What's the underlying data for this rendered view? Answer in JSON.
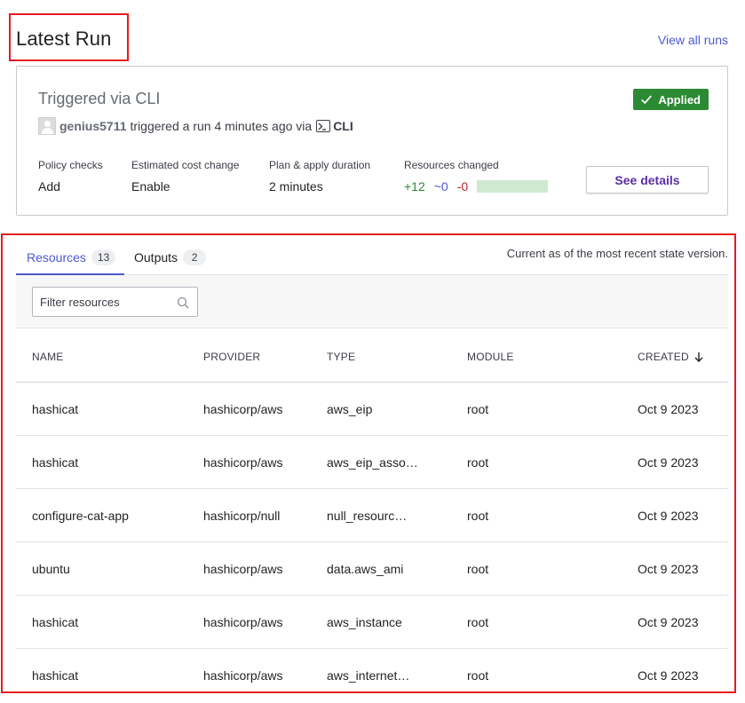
{
  "header": {
    "title": "Latest Run",
    "view_all_label": "View all runs"
  },
  "run": {
    "title": "Triggered via CLI",
    "status": "Applied",
    "username": "genius5711",
    "trigger_text": "triggered a run 4 minutes ago via",
    "trigger_source": "CLI",
    "stats": {
      "policy_label": "Policy checks",
      "policy_value": "Add",
      "cost_label": "Estimated cost change",
      "cost_value": "Enable",
      "duration_label": "Plan & apply duration",
      "duration_value": "2 minutes",
      "resources_label": "Resources changed",
      "added": "+12",
      "changed": "~0",
      "destroyed": "-0"
    },
    "details_button": "See details"
  },
  "resources_panel": {
    "tabs": [
      {
        "label": "Resources",
        "count": "13"
      },
      {
        "label": "Outputs",
        "count": "2"
      }
    ],
    "state_note": "Current as of the most recent state version.",
    "filter_placeholder": "Filter resources",
    "columns": {
      "name": "NAME",
      "provider": "PROVIDER",
      "type": "TYPE",
      "module": "MODULE",
      "created": "CREATED"
    },
    "rows": [
      {
        "name": "hashicat",
        "provider": "hashicorp/aws",
        "type": "aws_eip",
        "module": "root",
        "created": "Oct 9 2023"
      },
      {
        "name": "hashicat",
        "provider": "hashicorp/aws",
        "type": "aws_eip_asso…",
        "module": "root",
        "created": "Oct 9 2023"
      },
      {
        "name": "configure-cat-app",
        "provider": "hashicorp/null",
        "type": "null_resourc…",
        "module": "root",
        "created": "Oct 9 2023"
      },
      {
        "name": "ubuntu",
        "provider": "hashicorp/aws",
        "type": "data.aws_ami",
        "module": "root",
        "created": "Oct 9 2023"
      },
      {
        "name": "hashicat",
        "provider": "hashicorp/aws",
        "type": "aws_instance",
        "module": "root",
        "created": "Oct 9 2023"
      },
      {
        "name": "hashicat",
        "provider": "hashicorp/aws",
        "type": "aws_internet…",
        "module": "root",
        "created": "Oct 9 2023"
      }
    ]
  },
  "colors": {
    "accent": "#4c59d6",
    "applied": "#2c8a34",
    "highlight_border": "#e51a22",
    "details_text": "#5b2ea6"
  }
}
